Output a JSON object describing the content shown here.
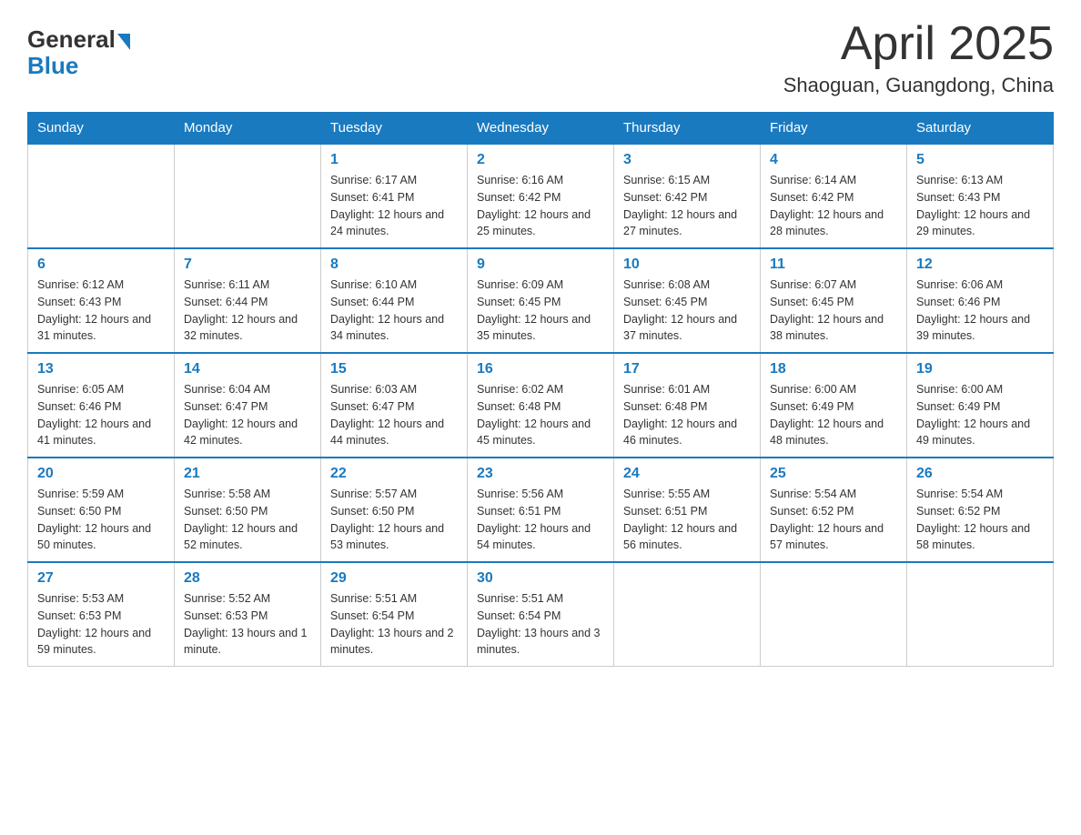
{
  "header": {
    "logo_general": "General",
    "logo_blue": "Blue",
    "month_title": "April 2025",
    "location": "Shaoguan, Guangdong, China"
  },
  "weekdays": [
    "Sunday",
    "Monday",
    "Tuesday",
    "Wednesday",
    "Thursday",
    "Friday",
    "Saturday"
  ],
  "weeks": [
    [
      {
        "day": "",
        "sunrise": "",
        "sunset": "",
        "daylight": ""
      },
      {
        "day": "",
        "sunrise": "",
        "sunset": "",
        "daylight": ""
      },
      {
        "day": "1",
        "sunrise": "Sunrise: 6:17 AM",
        "sunset": "Sunset: 6:41 PM",
        "daylight": "Daylight: 12 hours and 24 minutes."
      },
      {
        "day": "2",
        "sunrise": "Sunrise: 6:16 AM",
        "sunset": "Sunset: 6:42 PM",
        "daylight": "Daylight: 12 hours and 25 minutes."
      },
      {
        "day": "3",
        "sunrise": "Sunrise: 6:15 AM",
        "sunset": "Sunset: 6:42 PM",
        "daylight": "Daylight: 12 hours and 27 minutes."
      },
      {
        "day": "4",
        "sunrise": "Sunrise: 6:14 AM",
        "sunset": "Sunset: 6:42 PM",
        "daylight": "Daylight: 12 hours and 28 minutes."
      },
      {
        "day": "5",
        "sunrise": "Sunrise: 6:13 AM",
        "sunset": "Sunset: 6:43 PM",
        "daylight": "Daylight: 12 hours and 29 minutes."
      }
    ],
    [
      {
        "day": "6",
        "sunrise": "Sunrise: 6:12 AM",
        "sunset": "Sunset: 6:43 PM",
        "daylight": "Daylight: 12 hours and 31 minutes."
      },
      {
        "day": "7",
        "sunrise": "Sunrise: 6:11 AM",
        "sunset": "Sunset: 6:44 PM",
        "daylight": "Daylight: 12 hours and 32 minutes."
      },
      {
        "day": "8",
        "sunrise": "Sunrise: 6:10 AM",
        "sunset": "Sunset: 6:44 PM",
        "daylight": "Daylight: 12 hours and 34 minutes."
      },
      {
        "day": "9",
        "sunrise": "Sunrise: 6:09 AM",
        "sunset": "Sunset: 6:45 PM",
        "daylight": "Daylight: 12 hours and 35 minutes."
      },
      {
        "day": "10",
        "sunrise": "Sunrise: 6:08 AM",
        "sunset": "Sunset: 6:45 PM",
        "daylight": "Daylight: 12 hours and 37 minutes."
      },
      {
        "day": "11",
        "sunrise": "Sunrise: 6:07 AM",
        "sunset": "Sunset: 6:45 PM",
        "daylight": "Daylight: 12 hours and 38 minutes."
      },
      {
        "day": "12",
        "sunrise": "Sunrise: 6:06 AM",
        "sunset": "Sunset: 6:46 PM",
        "daylight": "Daylight: 12 hours and 39 minutes."
      }
    ],
    [
      {
        "day": "13",
        "sunrise": "Sunrise: 6:05 AM",
        "sunset": "Sunset: 6:46 PM",
        "daylight": "Daylight: 12 hours and 41 minutes."
      },
      {
        "day": "14",
        "sunrise": "Sunrise: 6:04 AM",
        "sunset": "Sunset: 6:47 PM",
        "daylight": "Daylight: 12 hours and 42 minutes."
      },
      {
        "day": "15",
        "sunrise": "Sunrise: 6:03 AM",
        "sunset": "Sunset: 6:47 PM",
        "daylight": "Daylight: 12 hours and 44 minutes."
      },
      {
        "day": "16",
        "sunrise": "Sunrise: 6:02 AM",
        "sunset": "Sunset: 6:48 PM",
        "daylight": "Daylight: 12 hours and 45 minutes."
      },
      {
        "day": "17",
        "sunrise": "Sunrise: 6:01 AM",
        "sunset": "Sunset: 6:48 PM",
        "daylight": "Daylight: 12 hours and 46 minutes."
      },
      {
        "day": "18",
        "sunrise": "Sunrise: 6:00 AM",
        "sunset": "Sunset: 6:49 PM",
        "daylight": "Daylight: 12 hours and 48 minutes."
      },
      {
        "day": "19",
        "sunrise": "Sunrise: 6:00 AM",
        "sunset": "Sunset: 6:49 PM",
        "daylight": "Daylight: 12 hours and 49 minutes."
      }
    ],
    [
      {
        "day": "20",
        "sunrise": "Sunrise: 5:59 AM",
        "sunset": "Sunset: 6:50 PM",
        "daylight": "Daylight: 12 hours and 50 minutes."
      },
      {
        "day": "21",
        "sunrise": "Sunrise: 5:58 AM",
        "sunset": "Sunset: 6:50 PM",
        "daylight": "Daylight: 12 hours and 52 minutes."
      },
      {
        "day": "22",
        "sunrise": "Sunrise: 5:57 AM",
        "sunset": "Sunset: 6:50 PM",
        "daylight": "Daylight: 12 hours and 53 minutes."
      },
      {
        "day": "23",
        "sunrise": "Sunrise: 5:56 AM",
        "sunset": "Sunset: 6:51 PM",
        "daylight": "Daylight: 12 hours and 54 minutes."
      },
      {
        "day": "24",
        "sunrise": "Sunrise: 5:55 AM",
        "sunset": "Sunset: 6:51 PM",
        "daylight": "Daylight: 12 hours and 56 minutes."
      },
      {
        "day": "25",
        "sunrise": "Sunrise: 5:54 AM",
        "sunset": "Sunset: 6:52 PM",
        "daylight": "Daylight: 12 hours and 57 minutes."
      },
      {
        "day": "26",
        "sunrise": "Sunrise: 5:54 AM",
        "sunset": "Sunset: 6:52 PM",
        "daylight": "Daylight: 12 hours and 58 minutes."
      }
    ],
    [
      {
        "day": "27",
        "sunrise": "Sunrise: 5:53 AM",
        "sunset": "Sunset: 6:53 PM",
        "daylight": "Daylight: 12 hours and 59 minutes."
      },
      {
        "day": "28",
        "sunrise": "Sunrise: 5:52 AM",
        "sunset": "Sunset: 6:53 PM",
        "daylight": "Daylight: 13 hours and 1 minute."
      },
      {
        "day": "29",
        "sunrise": "Sunrise: 5:51 AM",
        "sunset": "Sunset: 6:54 PM",
        "daylight": "Daylight: 13 hours and 2 minutes."
      },
      {
        "day": "30",
        "sunrise": "Sunrise: 5:51 AM",
        "sunset": "Sunset: 6:54 PM",
        "daylight": "Daylight: 13 hours and 3 minutes."
      },
      {
        "day": "",
        "sunrise": "",
        "sunset": "",
        "daylight": ""
      },
      {
        "day": "",
        "sunrise": "",
        "sunset": "",
        "daylight": ""
      },
      {
        "day": "",
        "sunrise": "",
        "sunset": "",
        "daylight": ""
      }
    ]
  ]
}
